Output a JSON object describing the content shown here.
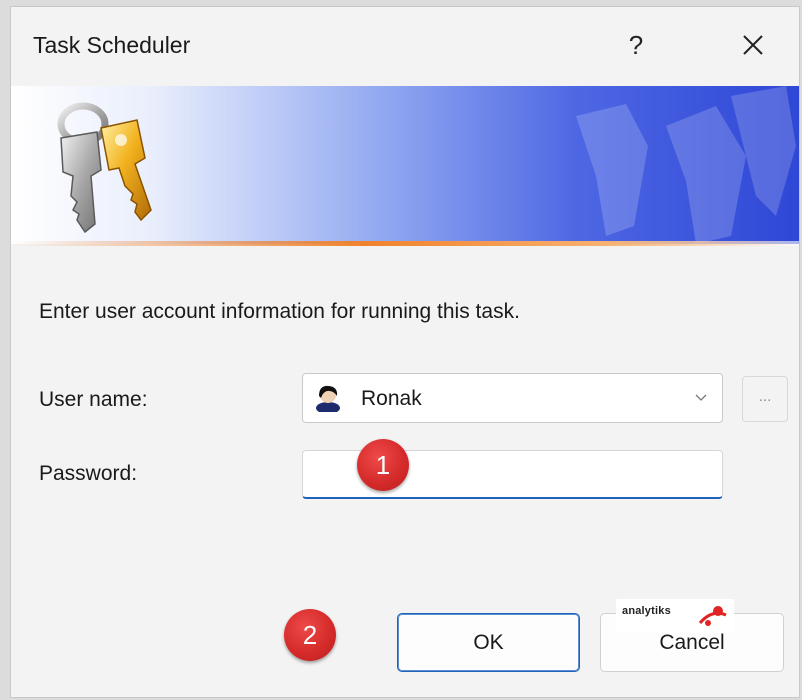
{
  "window": {
    "title": "Task Scheduler",
    "help_label": "?",
    "close_icon": "close-icon"
  },
  "banner": {
    "icon": "keys-icon",
    "accent_color": "#f0822c",
    "gradient_end_color": "#2f47d6"
  },
  "form": {
    "instruction": "Enter user account information for running this task.",
    "username_label": "User name:",
    "username_value": "Ronak",
    "username_icon": "user-avatar-icon",
    "browse_label": "...",
    "password_label": "Password:",
    "password_value": ""
  },
  "annotations": {
    "step1": "1",
    "step2": "2",
    "badge_color": "#d62b2b"
  },
  "buttons": {
    "ok_label": "OK",
    "cancel_label": "Cancel"
  },
  "watermark": {
    "text": "analytiks"
  }
}
